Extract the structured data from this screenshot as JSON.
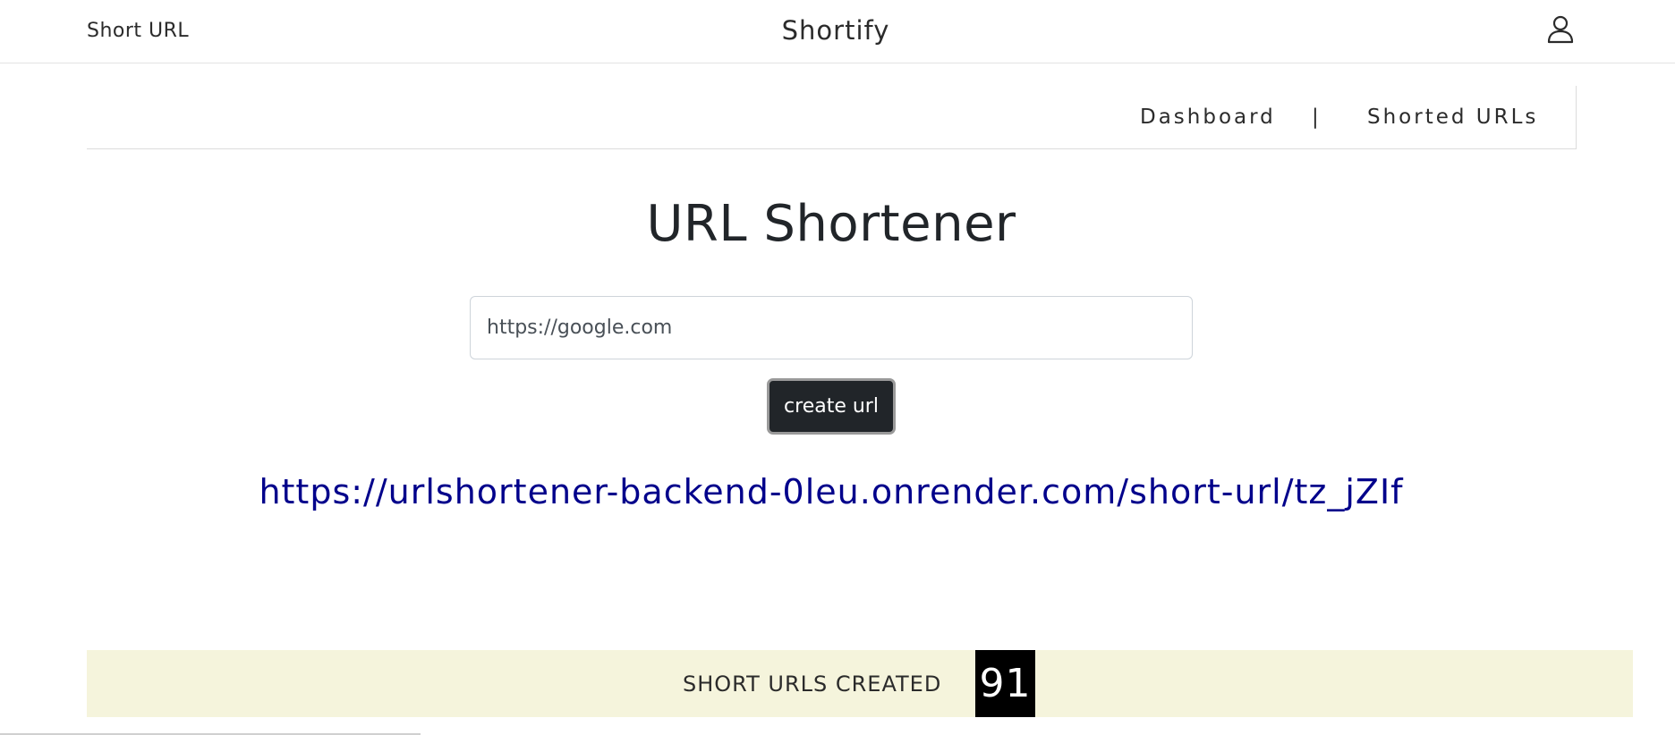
{
  "header": {
    "left_brand": "Short URL",
    "center_brand": "Shortify",
    "user_icon": "user-icon"
  },
  "subnav": {
    "dashboard": "Dashboard",
    "separator": "|",
    "shorted_urls": "Shorted URLs"
  },
  "main": {
    "title": "URL Shortener",
    "input_value": "https://google.com",
    "create_button": "create url",
    "short_url": "https://urlshortener-backend-0leu.onrender.com/short-url/tz_jZIf"
  },
  "stats": {
    "label": "SHORT URLS CREATED",
    "count": "91"
  }
}
